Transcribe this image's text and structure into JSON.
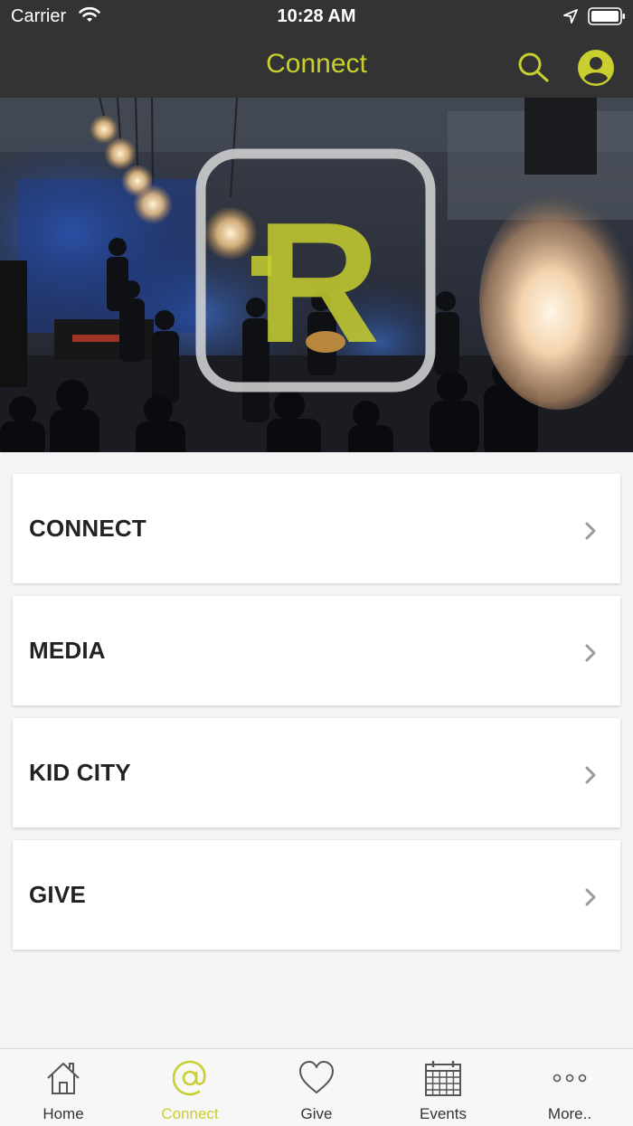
{
  "status_bar": {
    "carrier": "Carrier",
    "time": "10:28 AM"
  },
  "nav": {
    "title": "Connect",
    "accent_color": "#c8cf2e"
  },
  "hero": {
    "logo_letter": "R",
    "icon": "church-worship-band-photo"
  },
  "menu": {
    "items": [
      {
        "label": "CONNECT"
      },
      {
        "label": "MEDIA"
      },
      {
        "label": "KID CITY"
      },
      {
        "label": "GIVE"
      }
    ]
  },
  "tabbar": {
    "tabs": [
      {
        "label": "Home",
        "icon": "home-icon"
      },
      {
        "label": "Connect",
        "icon": "at-icon",
        "active": true
      },
      {
        "label": "Give",
        "icon": "heart-icon"
      },
      {
        "label": "Events",
        "icon": "calendar-icon"
      },
      {
        "label": "More..",
        "icon": "more-icon"
      }
    ]
  }
}
